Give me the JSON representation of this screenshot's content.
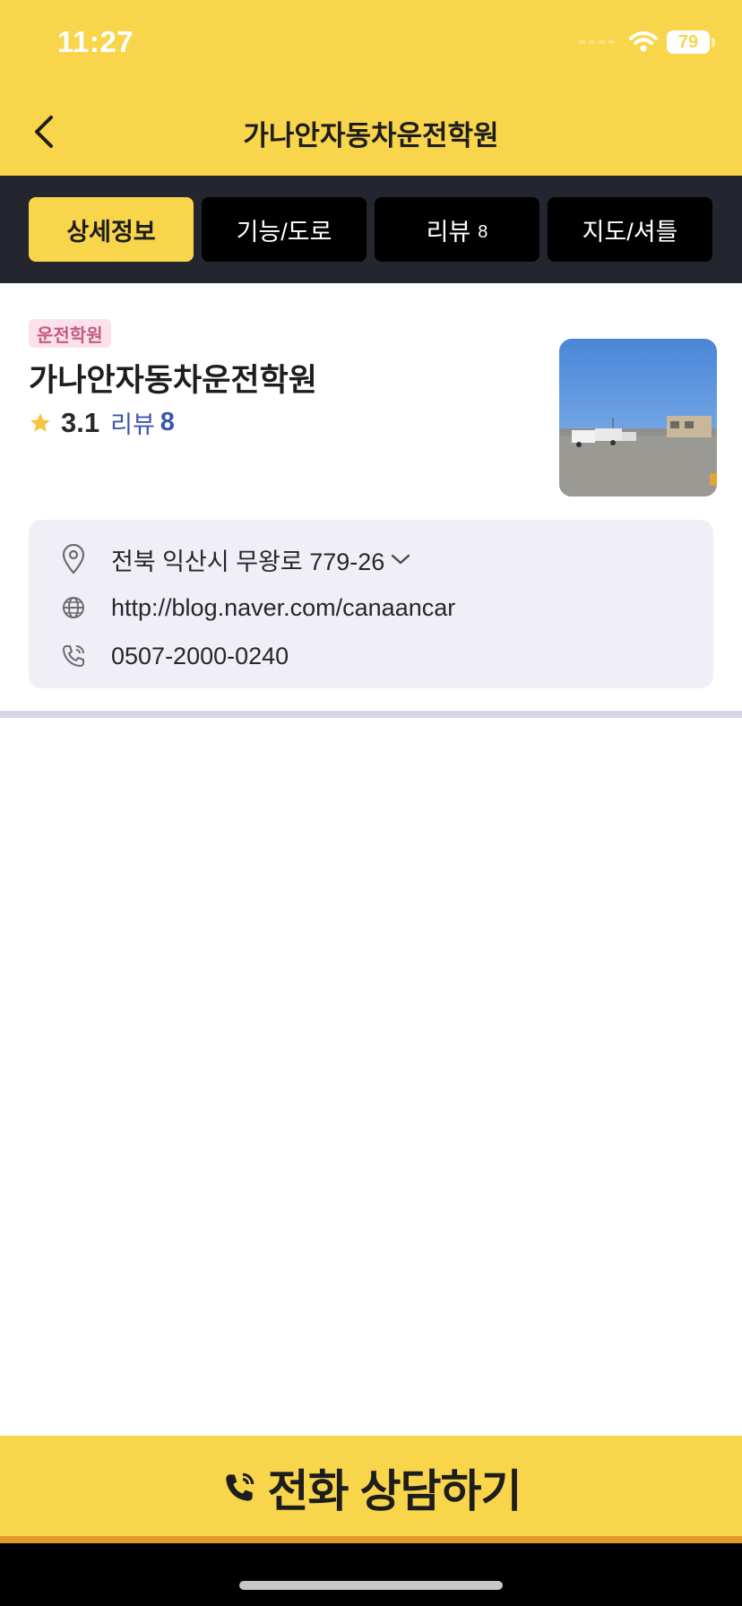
{
  "status_bar": {
    "time": "11:27",
    "battery": "79"
  },
  "header": {
    "title": "가나안자동차운전학원"
  },
  "tabs": [
    {
      "label": "상세정보",
      "count": ""
    },
    {
      "label": "기능/도로",
      "count": ""
    },
    {
      "label": "리뷰",
      "count": "8"
    },
    {
      "label": "지도/셔틀",
      "count": ""
    }
  ],
  "place": {
    "category": "운전학원",
    "name": "가나안자동차운전학원",
    "rating": "3.1",
    "review_label": "리뷰",
    "review_count": "8"
  },
  "info": {
    "address": "전북 익산시 무왕로 779-26",
    "website": "http://blog.naver.com/canaancar",
    "phone": "0507-2000-0240"
  },
  "cta": {
    "label": "전화 상담하기"
  },
  "colors": {
    "brand_yellow": "#f8d54a",
    "tab_bar": "#23252f",
    "review_blue": "#3d55b0",
    "badge_pink": "#c45a86"
  }
}
